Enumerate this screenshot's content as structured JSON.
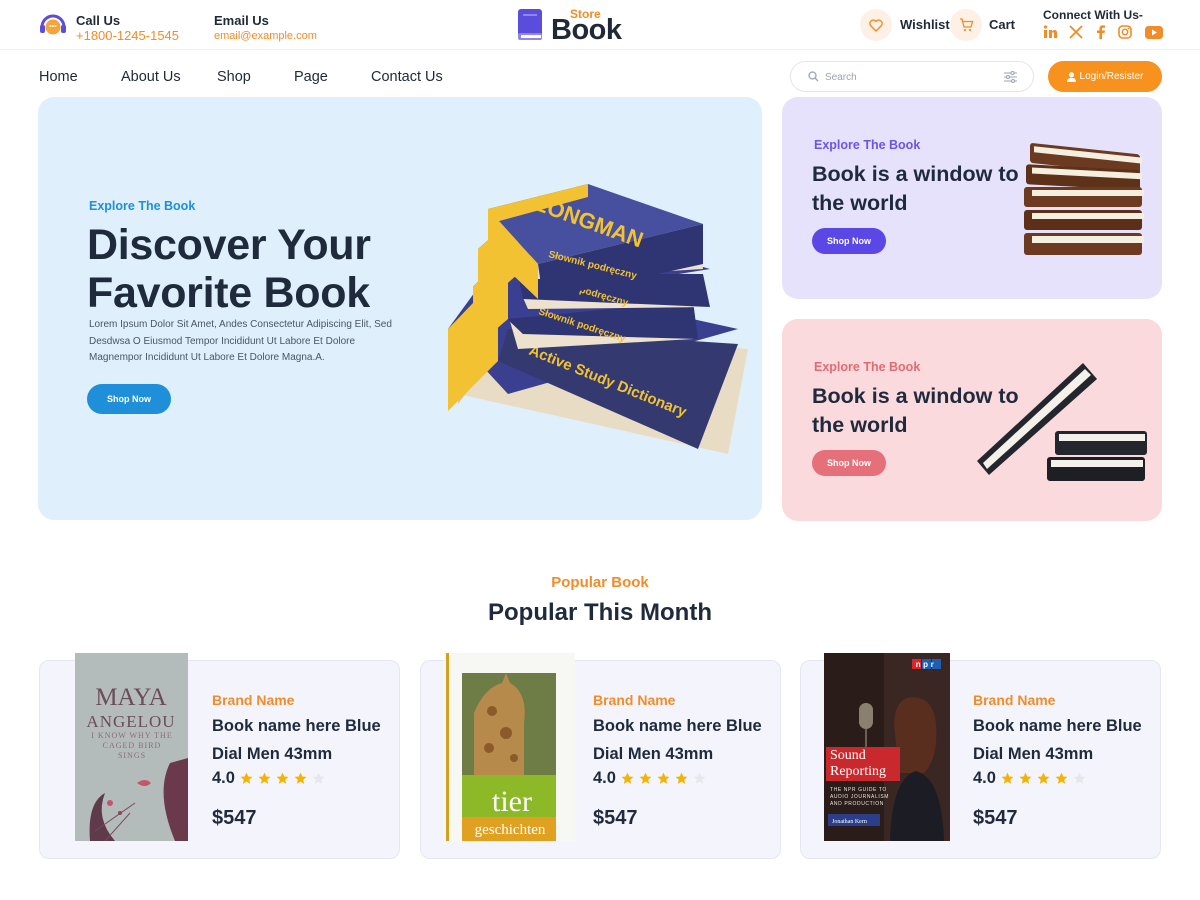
{
  "topbar": {
    "call": {
      "label": "Call Us",
      "value": "+1800-1245-1545"
    },
    "email": {
      "label": "Email Us",
      "value": "email@example.com"
    },
    "logo": {
      "store": "Store",
      "book": "Book"
    },
    "wishlist_label": "Wishlist",
    "cart_label": "Cart",
    "connect_label": "Connect With Us-",
    "social_icons": [
      "linkedin-icon",
      "x-icon",
      "facebook-icon",
      "instagram-icon",
      "youtube-icon"
    ]
  },
  "nav": {
    "items": [
      "Home",
      "About Us",
      "Shop",
      "Page",
      "Contact Us"
    ],
    "search_placeholder": "Search",
    "login_label": "Login/Resister"
  },
  "hero": {
    "eyebrow": "Explore The Book",
    "title": "Discover Your Favorite Book",
    "description": "Lorem Ipsum Dolor Sit Amet, Andes Consectetur Adipiscing Elit, Sed Desdwsa O Eiusmod Tempor Incididunt Ut Labore Et Dolore Magnempor Incididunt Ut Labore Et Dolore Magna.A.",
    "button": "Shop Now",
    "book_spines": [
      "Słownik podręczny",
      "Słownik podręczny",
      "Słownik podręczny",
      "Active Study Dictionary"
    ],
    "book_brand": "LONGMAN"
  },
  "side_cards": [
    {
      "eyebrow": "Explore The Book",
      "title": "Book is a window to the world",
      "button": "Shop Now"
    },
    {
      "eyebrow": "Explore The Book",
      "title": "Book is a window to the world",
      "button": "Shop Now"
    }
  ],
  "popular": {
    "eyebrow": "Popular Book",
    "title": "Popular This Month",
    "books": [
      {
        "brand": "Brand Name",
        "name": "Book name here  Blue Dial Men 43mm",
        "rating": "4.0",
        "stars": 4,
        "price": "$547",
        "cover": {
          "line1": "MAYA",
          "line2": "ANGELOU",
          "line3": "I KNOW WHY THE CAGED BIRD SINGS"
        }
      },
      {
        "brand": "Brand Name",
        "name": "Book name here  Blue Dial Men 43mm",
        "rating": "4.0",
        "stars": 4,
        "price": "$547",
        "cover": {
          "line1": "tier",
          "line2": "geschichten"
        }
      },
      {
        "brand": "Brand Name",
        "name": "Book name here  Blue Dial Men 43mm",
        "rating": "4.0",
        "stars": 4,
        "price": "$547",
        "cover": {
          "badge": "npr",
          "line1": "Sound Reporting",
          "line2": "THE NPR GUIDE TO AUDIO JOURNALISM AND PRODUCTION",
          "author": "Jonathan Kern"
        }
      }
    ]
  },
  "colors": {
    "accent_orange": "#f28c28",
    "hero_blue": "#1e8fd8",
    "purple": "#5b47e6",
    "pink": "#e6707a",
    "logo_purple": "#5b4ddb"
  }
}
